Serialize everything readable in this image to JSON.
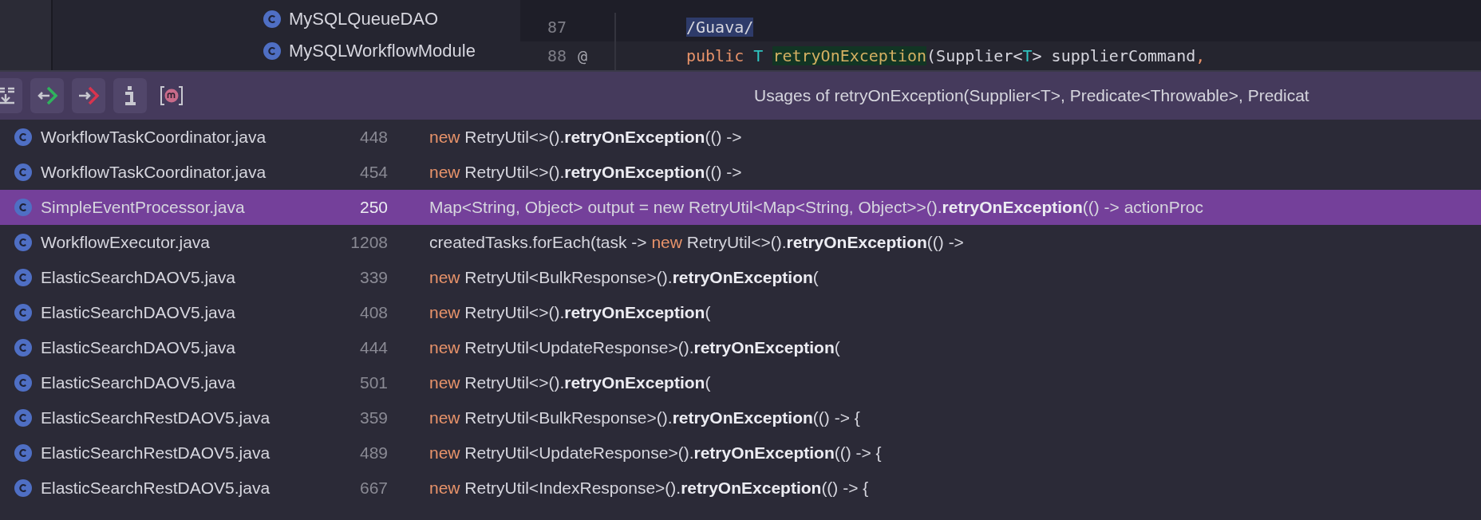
{
  "project_tree": {
    "items": [
      {
        "name": "MySQLQueueDAO",
        "selected": false
      },
      {
        "name": "MySQLWorkflowModule",
        "selected": false
      }
    ]
  },
  "editor": {
    "lines": [
      {
        "number": "87",
        "tokens": [
          {
            "kind": "highlight",
            "text": "/Guava/"
          }
        ]
      },
      {
        "number": "88",
        "gutter": "@",
        "tokens": [
          {
            "kind": "keyword",
            "text": "public "
          },
          {
            "kind": "type",
            "text": "T "
          },
          {
            "kind": "match",
            "text": "retryOnException"
          },
          {
            "kind": "plain",
            "text": "(Supplier<"
          },
          {
            "kind": "type",
            "text": "T"
          },
          {
            "kind": "plain",
            "text": "> supplierCommand"
          },
          {
            "kind": "keyword",
            "text": ","
          }
        ]
      }
    ]
  },
  "usages": {
    "title": "Usages of retryOnException(Supplier<T>, Predicate<Throwable>, Predicat",
    "rows": [
      {
        "file": "WorkflowTaskCoordinator.java",
        "line": "448",
        "selected": false,
        "code": [
          {
            "kind": "keyword",
            "text": "new "
          },
          {
            "kind": "plain",
            "text": "RetryUtil<>()."
          },
          {
            "kind": "bold",
            "text": "retryOnException"
          },
          {
            "kind": "plain",
            "text": "(() ->"
          }
        ]
      },
      {
        "file": "WorkflowTaskCoordinator.java",
        "line": "454",
        "selected": false,
        "code": [
          {
            "kind": "keyword",
            "text": "new "
          },
          {
            "kind": "plain",
            "text": "RetryUtil<>()."
          },
          {
            "kind": "bold",
            "text": "retryOnException"
          },
          {
            "kind": "plain",
            "text": "(() ->"
          }
        ]
      },
      {
        "file": "SimpleEventProcessor.java",
        "line": "250",
        "selected": true,
        "code": [
          {
            "kind": "plain",
            "text": "Map<String, Object> output = new RetryUtil<Map<String, Object>>()."
          },
          {
            "kind": "bold",
            "text": "retryOnException"
          },
          {
            "kind": "plain",
            "text": "(() -> actionProc"
          }
        ]
      },
      {
        "file": "WorkflowExecutor.java",
        "line": "1208",
        "selected": false,
        "code": [
          {
            "kind": "plain",
            "text": "createdTasks.forEach(task -> "
          },
          {
            "kind": "keyword",
            "text": "new "
          },
          {
            "kind": "plain",
            "text": "RetryUtil<>()."
          },
          {
            "kind": "bold",
            "text": "retryOnException"
          },
          {
            "kind": "plain",
            "text": "(() ->"
          }
        ]
      },
      {
        "file": "ElasticSearchDAOV5.java",
        "line": "339",
        "selected": false,
        "code": [
          {
            "kind": "keyword",
            "text": "new "
          },
          {
            "kind": "plain",
            "text": "RetryUtil<BulkResponse>()."
          },
          {
            "kind": "bold",
            "text": "retryOnException"
          },
          {
            "kind": "plain",
            "text": "("
          }
        ]
      },
      {
        "file": "ElasticSearchDAOV5.java",
        "line": "408",
        "selected": false,
        "code": [
          {
            "kind": "keyword",
            "text": "new "
          },
          {
            "kind": "plain",
            "text": "RetryUtil<>()."
          },
          {
            "kind": "bold",
            "text": "retryOnException"
          },
          {
            "kind": "plain",
            "text": "("
          }
        ]
      },
      {
        "file": "ElasticSearchDAOV5.java",
        "line": "444",
        "selected": false,
        "code": [
          {
            "kind": "keyword",
            "text": "new "
          },
          {
            "kind": "plain",
            "text": "RetryUtil<UpdateResponse>()."
          },
          {
            "kind": "bold",
            "text": "retryOnException"
          },
          {
            "kind": "plain",
            "text": "("
          }
        ]
      },
      {
        "file": "ElasticSearchDAOV5.java",
        "line": "501",
        "selected": false,
        "code": [
          {
            "kind": "keyword",
            "text": "new "
          },
          {
            "kind": "plain",
            "text": "RetryUtil<>()."
          },
          {
            "kind": "bold",
            "text": "retryOnException"
          },
          {
            "kind": "plain",
            "text": "("
          }
        ]
      },
      {
        "file": "ElasticSearchRestDAOV5.java",
        "line": "359",
        "selected": false,
        "code": [
          {
            "kind": "keyword",
            "text": "new "
          },
          {
            "kind": "plain",
            "text": "RetryUtil<BulkResponse>()."
          },
          {
            "kind": "bold",
            "text": "retryOnException"
          },
          {
            "kind": "plain",
            "text": "(() -> {"
          }
        ]
      },
      {
        "file": "ElasticSearchRestDAOV5.java",
        "line": "489",
        "selected": false,
        "code": [
          {
            "kind": "keyword",
            "text": "new "
          },
          {
            "kind": "plain",
            "text": "RetryUtil<UpdateResponse>()."
          },
          {
            "kind": "bold",
            "text": "retryOnException"
          },
          {
            "kind": "plain",
            "text": "(() -> {"
          }
        ]
      },
      {
        "file": "ElasticSearchRestDAOV5.java",
        "line": "667",
        "selected": false,
        "code": [
          {
            "kind": "keyword",
            "text": "new "
          },
          {
            "kind": "plain",
            "text": "RetryUtil<IndexResponse>()."
          },
          {
            "kind": "bold",
            "text": "retryOnException"
          },
          {
            "kind": "plain",
            "text": "(() -> {"
          }
        ]
      }
    ]
  }
}
